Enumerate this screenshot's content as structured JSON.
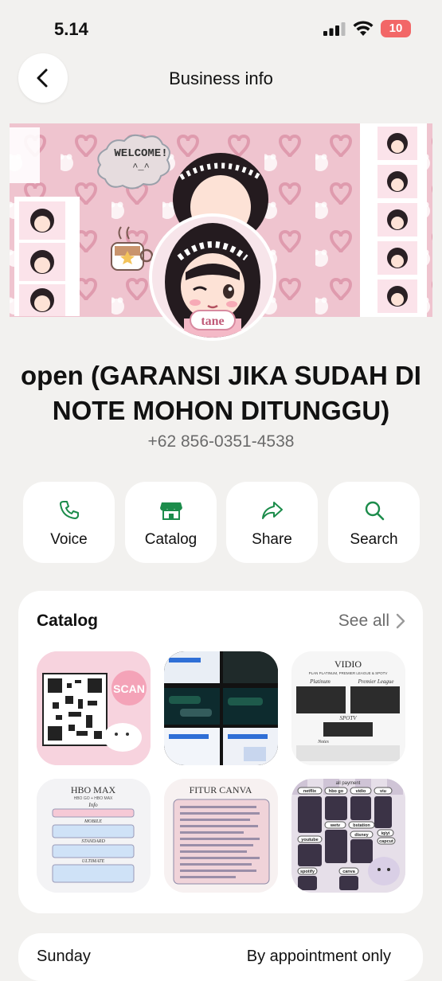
{
  "status_bar": {
    "time": "5.14",
    "battery": "10"
  },
  "header": {
    "title": "Business info"
  },
  "cover": {
    "welcome": "WELCOME!",
    "welcome_face": "^_^",
    "avatar_tag": "tane"
  },
  "profile": {
    "name": "open (GARANSI JIKA SUDAH DI NOTE MOHON DITUNGGU)",
    "phone": "+62 856-0351-4538"
  },
  "actions": [
    {
      "label": "Voice",
      "icon": "phone-icon"
    },
    {
      "label": "Catalog",
      "icon": "store-icon"
    },
    {
      "label": "Share",
      "icon": "share-icon"
    },
    {
      "label": "Search",
      "icon": "search-icon"
    }
  ],
  "catalog": {
    "title": "Catalog",
    "see_all": "See all",
    "items": [
      {
        "caption": "SCAN"
      },
      {
        "caption": ""
      },
      {
        "caption": "VIDIO",
        "sub": "PLAN PLATINUM, PREMIER LEAGUE & SPOTV",
        "col1": "Platinum",
        "col2": "Premier League",
        "section": "SPOTV",
        "notes": "Notes"
      },
      {
        "caption": "HBO MAX",
        "sub": "HBO GO + HBO MAX",
        "sections": [
          "Info",
          "MOBILE",
          "STANDARD",
          "ULTIMATE"
        ]
      },
      {
        "caption": "FITUR CANVA"
      },
      {
        "caption": "all payment",
        "tags": [
          "netflix",
          "hbo go",
          "vidio",
          "viu",
          "wetv",
          "bstation",
          "iqiyi",
          "youtube",
          "disney",
          "capcut",
          "spotify",
          "canva"
        ]
      }
    ]
  },
  "hours": {
    "day": "Sunday",
    "value": "By appointment only"
  },
  "colors": {
    "accent": "#1c8c4b",
    "cover_pink": "#efc4cf",
    "battery": "#f26767"
  }
}
